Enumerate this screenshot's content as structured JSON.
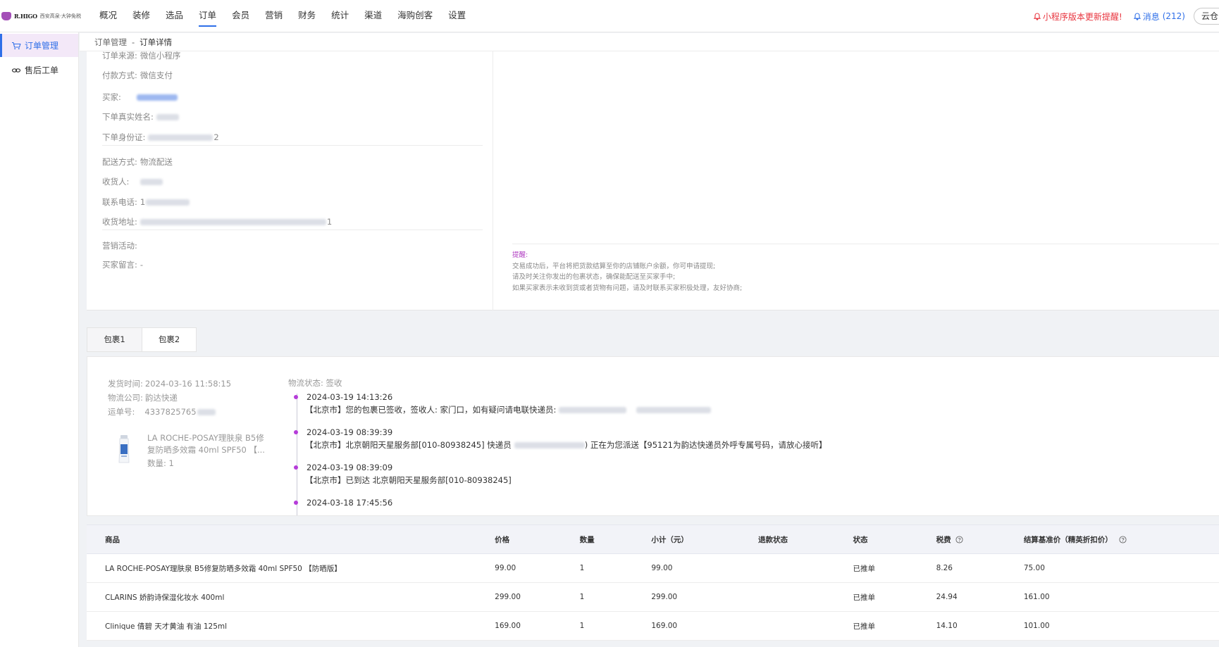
{
  "logo": {
    "brand": "R.HIGO",
    "sub": "西安高泉·大钟免税"
  },
  "nav": {
    "items": [
      "概况",
      "装修",
      "选品",
      "订单",
      "会员",
      "营销",
      "财务",
      "统计",
      "渠道",
      "海购创客",
      "设置"
    ],
    "active_index": 3
  },
  "header": {
    "update_alert": "小程序版本更新提醒!",
    "messages_label": "消息",
    "messages_count": "(212)",
    "cloud_label": "云仓"
  },
  "sidebar": {
    "items": [
      {
        "label": "订单管理",
        "icon": "cart-icon"
      },
      {
        "label": "售后工单",
        "icon": "link-icon"
      }
    ]
  },
  "breadcrumb": {
    "parent": "订单管理",
    "separator": "-",
    "current": "订单详情"
  },
  "order_info": {
    "source_label": "订单来源:",
    "source_value": "微信小程序",
    "payment_label": "付款方式:",
    "payment_value": "微信支付",
    "buyer_label": "买家:",
    "real_name_label": "下单真实姓名:",
    "id_card_label": "下单身份证:",
    "id_card_tail": "2",
    "delivery_label": "配送方式:",
    "delivery_value": "物流配送",
    "receiver_label": "收货人:",
    "phone_label": "联系电话:",
    "phone_head": "1",
    "address_label": "收货地址:",
    "address_tail": "1",
    "marketing_label": "营销活动:",
    "message_label": "买家留言:",
    "message_value": "-"
  },
  "reminder": {
    "title": "提醒:",
    "lines": [
      "交易成功后，平台将把货款结算至你的店铺账户余额，你可申请提现;",
      "请及时关注你发出的包裹状态，确保能配送至买家手中;",
      "如果买家表示未收到货或者货物有问题，请及时联系买家积极处理，友好协商;"
    ]
  },
  "packages": {
    "tabs": [
      "包裹1",
      "包裹2"
    ],
    "active_index": 0
  },
  "logistics": {
    "ship_time_label": "发货时间:",
    "ship_time": "2024-03-16 11:58:15",
    "company_label": "物流公司:",
    "company": "韵达快递",
    "tracking_label": "运单号:",
    "tracking_no": "4337825765",
    "product_name": "LA ROCHE-POSAY理肤泉 B5修复防晒多效霜 40ml SPF50 【...",
    "product_qty": "数量: 1",
    "status_label": "物流状态: 签收",
    "events": [
      {
        "time": "2024-03-19 14:13:26",
        "text": "【北京市】您的包裹已签收，签收人: 家门口，如有疑问请电联快递员:",
        "tail": ""
      },
      {
        "time": "2024-03-19 08:39:39",
        "text": "【北京市】北京朝阳天星服务部[010-80938245] 快递员",
        "tail": ") 正在为您派送【95121为韵达快递员外呼专属号码，请放心接听】"
      },
      {
        "time": "2024-03-19 08:39:09",
        "text": "【北京市】已到达 北京朝阳天星服务部[010-80938245]",
        "tail": ""
      },
      {
        "time": "2024-03-18 17:45:56",
        "text": "",
        "tail": ""
      }
    ]
  },
  "goods_table": {
    "columns": [
      "商品",
      "价格",
      "数量",
      "小计（元）",
      "退款状态",
      "状态",
      "税费",
      "结算基准价（精英折扣价）"
    ],
    "rows": [
      [
        "LA ROCHE-POSAY理肤泉 B5修复防晒多效霜 40ml SPF50 【防晒版】",
        "99.00",
        "1",
        "99.00",
        "",
        "已推单",
        "8.26",
        "75.00"
      ],
      [
        "CLARINS 娇韵诗保湿化妆水 400ml",
        "299.00",
        "1",
        "299.00",
        "",
        "已推单",
        "24.94",
        "161.00"
      ],
      [
        "Clinique 倩碧 天才黄油 有油 125ml",
        "169.00",
        "1",
        "169.00",
        "",
        "已推单",
        "14.10",
        "101.00"
      ]
    ]
  },
  "colors": {
    "accent": "#2f6fe8",
    "alert": "#e8343e",
    "timeline_dot": "#b53cd9",
    "reminder_title": "#b03ec2"
  }
}
